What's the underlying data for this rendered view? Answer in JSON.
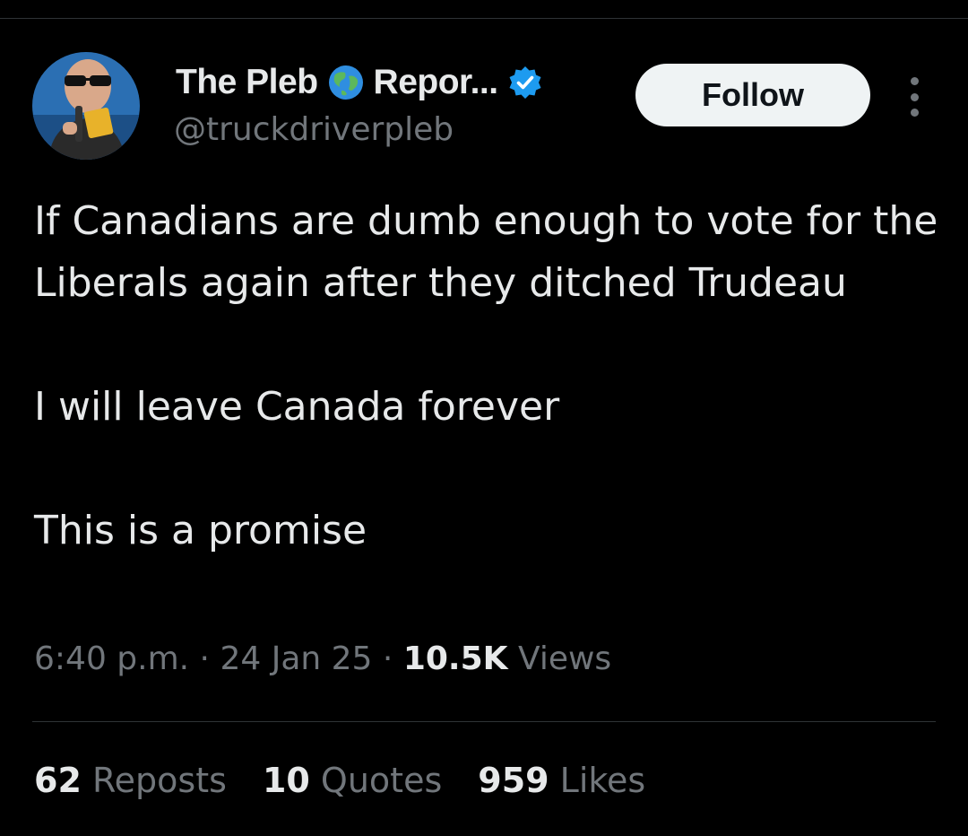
{
  "author": {
    "name_part1": "The Pleb",
    "name_part2": "Repor...",
    "handle": "@truckdriverpleb",
    "avatar_icon": "user-avatar",
    "name_emoji_icon": "globe-icon",
    "verified_icon": "verified-badge-icon"
  },
  "actions": {
    "follow_label": "Follow",
    "more_icon": "more-options-icon"
  },
  "tweet": {
    "lines": [
      "If Canadians are dumb enough to vote for the Liberals again after they ditched Trudeau",
      "I will leave Canada forever",
      "This is a promise"
    ]
  },
  "meta": {
    "time": "6:40 p.m.",
    "separator": "·",
    "date": "24 Jan 25",
    "views_count": "10.5K",
    "views_label": "Views"
  },
  "stats": [
    {
      "count": "62",
      "label": "Reposts"
    },
    {
      "count": "10",
      "label": "Quotes"
    },
    {
      "count": "959",
      "label": "Likes"
    }
  ],
  "colors": {
    "background": "#000000",
    "primary_text": "#e7e9ea",
    "secondary_text": "#71767b",
    "verified": "#1d9bf0",
    "button_bg": "#eff3f4"
  }
}
